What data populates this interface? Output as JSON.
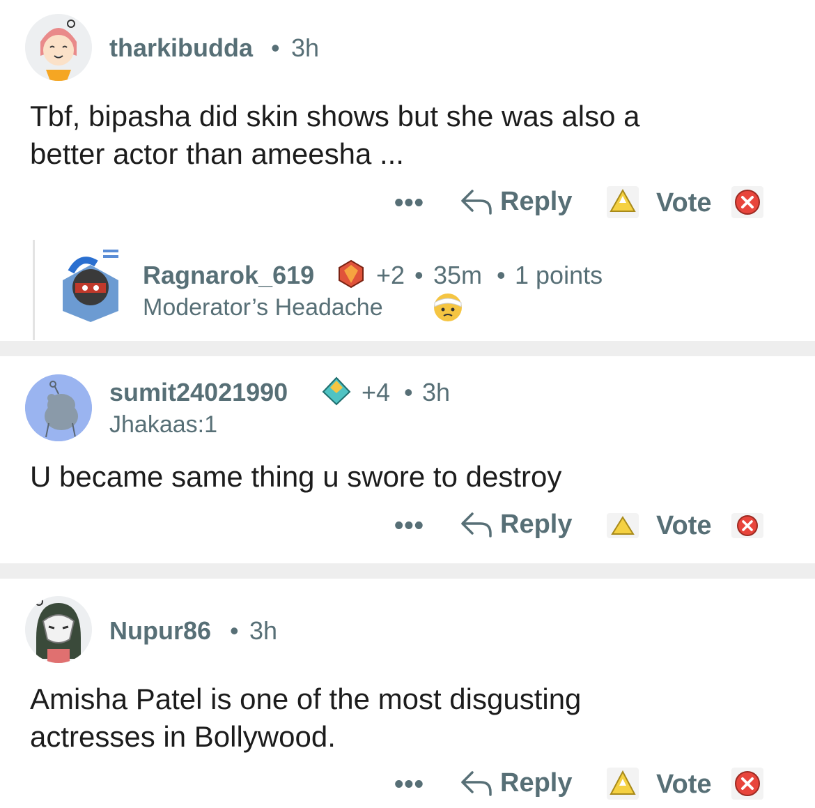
{
  "comments": [
    {
      "username": "tharkibudda",
      "sep": "•",
      "time": "3h",
      "text_line1": "Tbf, bipasha did skin shows but she was also a",
      "text_line2": "better actor than ameesha ...",
      "actions": {
        "more": "•••",
        "reply": "Reply",
        "vote": "Vote"
      }
    },
    {
      "username": "Ragnarok_619",
      "karma": "+2",
      "sep": "•",
      "time": "35m",
      "sep2": "•",
      "points": "1 points",
      "flair": "Moderator’s Headache"
    },
    {
      "username": "sumit24021990",
      "karma": "+4",
      "sep": "•",
      "time": "3h",
      "flair": "Jhakaas:1",
      "text": "U became same thing u swore to destroy",
      "actions": {
        "more": "•••",
        "reply": "Reply",
        "vote": "Vote"
      }
    },
    {
      "username": "Nupur86",
      "sep": "•",
      "time": "3h",
      "text_line1": "Amisha Patel is one of the most disgusting",
      "text_line2": "actresses in Bollywood.",
      "actions": {
        "more": "•••",
        "reply": "Reply",
        "vote": "Vote"
      }
    }
  ],
  "colors": {
    "meta_gray": "#576f76",
    "text": "#1c1c1c",
    "upvote_yellow": "#f5d142",
    "downvote_red": "#e8453c",
    "divider": "#eeeeee"
  },
  "icons": [
    "avatar-tharkibudda",
    "avatar-ragnarok",
    "avatar-sumit",
    "avatar-nupur",
    "reply-arrow-icon",
    "upvote-icon",
    "downvote-icon",
    "ruby-award-icon",
    "diamond-award-icon",
    "bandaged-face-emoji-icon"
  ]
}
